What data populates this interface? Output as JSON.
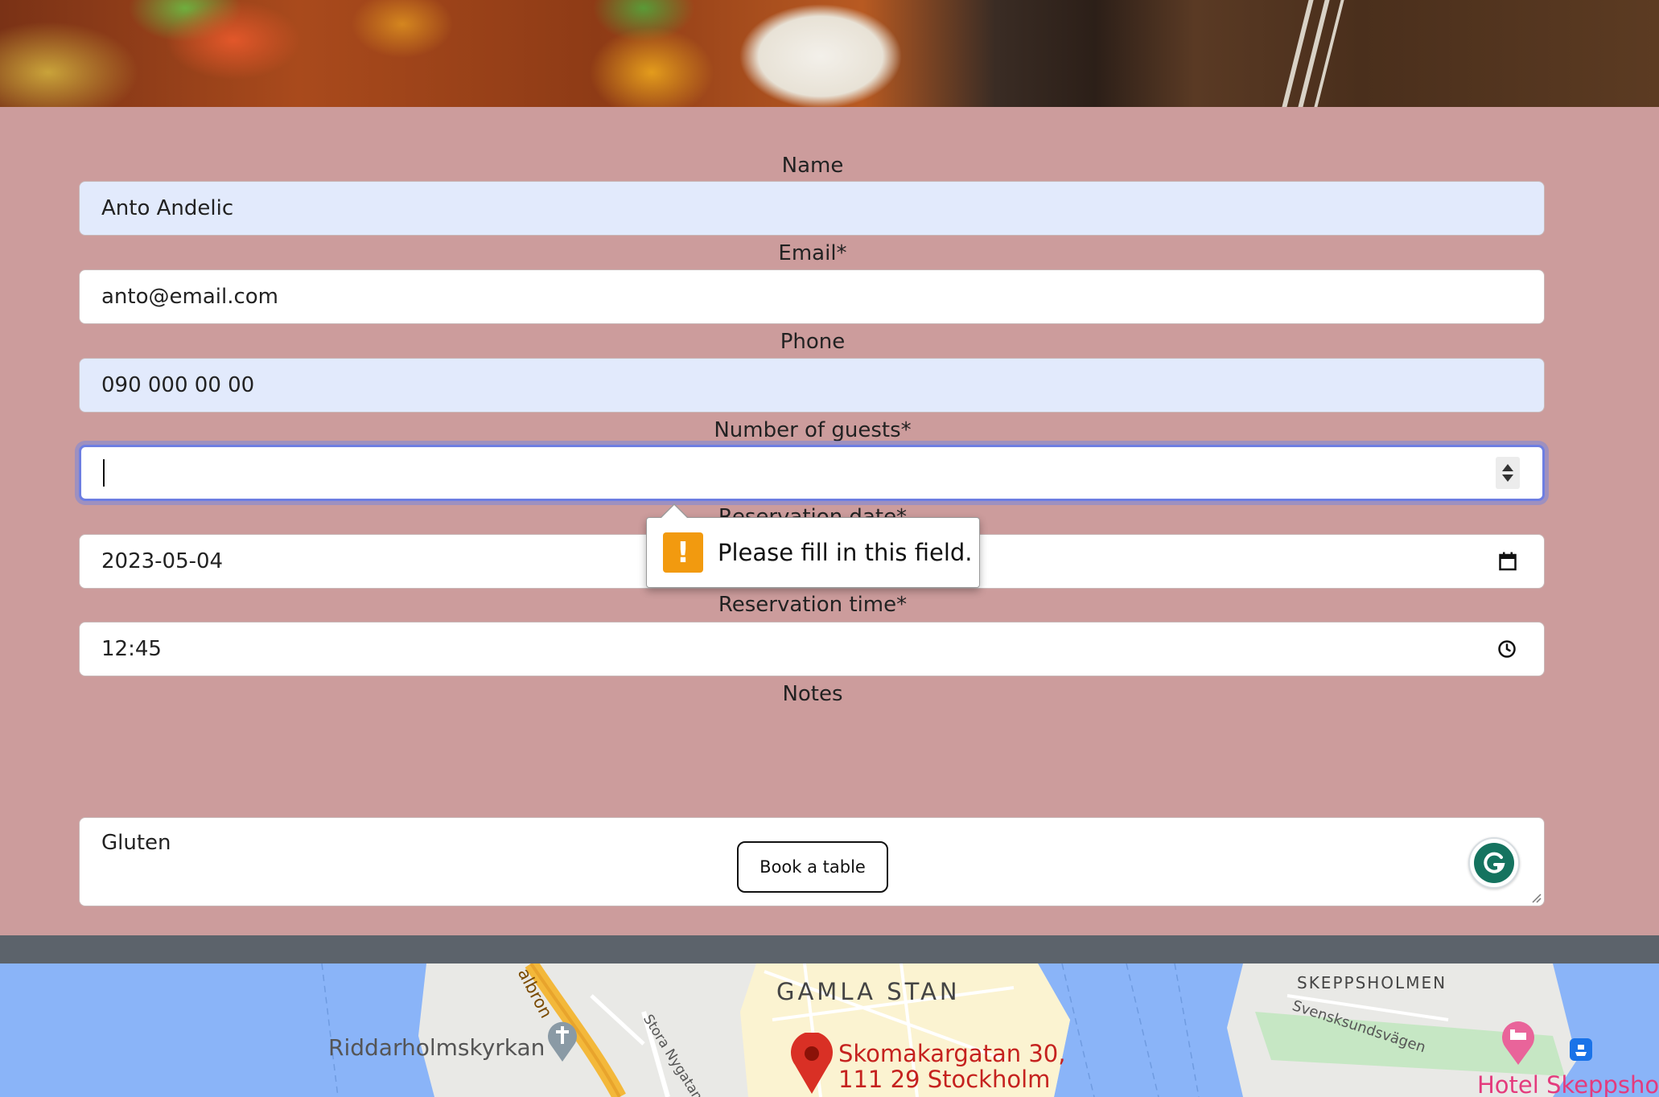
{
  "form": {
    "name": {
      "label": "Name",
      "value": "Anto Andelic"
    },
    "email": {
      "label": "Email*",
      "value": "anto@email.com"
    },
    "phone": {
      "label": "Phone",
      "value": "090 000 00 00"
    },
    "guests": {
      "label": "Number of guests*",
      "value": ""
    },
    "date": {
      "label": "Reservation date*",
      "value": "2023-05-04"
    },
    "time": {
      "label": "Reservation time*",
      "value": "12:45"
    },
    "notes": {
      "label": "Notes",
      "value": "Gluten"
    },
    "submit_label": "Book a table"
  },
  "validation": {
    "message": "Please fill in this field.",
    "icon": "warning-icon",
    "color": "#f29a0f"
  },
  "colors": {
    "form_background": "#cc9c9c",
    "divider": "#5c636b",
    "autofill": "#e2eafc",
    "focus_ring": "#6d7ee2",
    "map_marker": "#d93025",
    "grammarly": "#15735f"
  },
  "map": {
    "district_gamla_stan": "GAMLA STAN",
    "district_skeppsholmen": "SKEPPSHOLMEN",
    "street_stora_nygatan": "Stora Nygatan",
    "street_svensksundsvagen": "Svensksundsvägen",
    "street_partial": "albron",
    "landmark_church": "Riddarholmskyrkan",
    "marker_address_line1": "Skomakargatan 30,",
    "marker_address_line2": "111 29 Stockholm",
    "hotel_label": "Hotel Skeppshol"
  }
}
